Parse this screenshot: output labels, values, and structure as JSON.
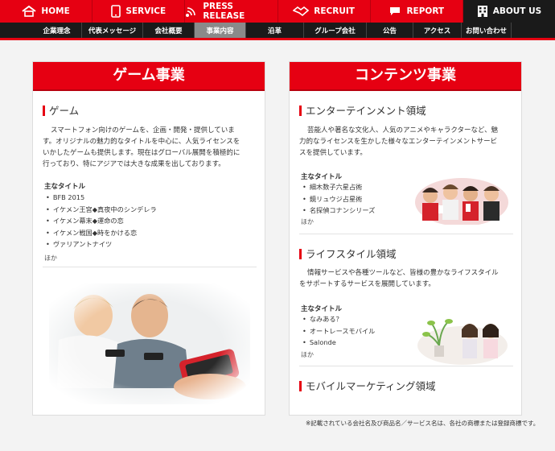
{
  "topnav": [
    {
      "label": "HOME",
      "icon": "home-icon"
    },
    {
      "label": "SERVICE",
      "icon": "smartphone-icon"
    },
    {
      "label": "PRESS RELEASE",
      "icon": "broadcast-icon"
    },
    {
      "label": "RECRUIT",
      "icon": "handshake-icon"
    },
    {
      "label": "REPORT",
      "icon": "chat-bubble-icon"
    },
    {
      "label": "ABOUT US",
      "icon": "building-icon"
    }
  ],
  "subnav": [
    "企業理念",
    "代表メッセージ",
    "会社概要",
    "事業内容",
    "沿革",
    "グループ会社",
    "公告",
    "アクセス",
    "お問い合わせ"
  ],
  "left": {
    "title": "ゲーム事業",
    "heading": "ゲーム",
    "text1": "スマートフォン向けのゲームを、企画・開発・提供していま",
    "text2": "す。オリジナルの魅力的なタイトルを中心に、人気ライセンスを",
    "text3": "いかしたゲームも提供します。現在はグローバル展開を積極的に",
    "text4": "行っており、特にアジアでは大きな成果を出しております。",
    "titles_label": "主なタイトル",
    "titles": [
      "BFB 2015",
      "イケメン王宮◆真夜中のシンデレラ",
      "イケメン幕末◆運命の恋",
      "イケメン戦国◆時をかける恋",
      "ヴァリアントナイツ"
    ],
    "other": "ほか"
  },
  "right": {
    "title": "コンテンツ事業",
    "ent": {
      "heading": "エンターテインメント領域",
      "text1": "芸能人や著名な文化人、人気のアニメやキャラクターなど、魅",
      "text2": "力的なライセンスを生かした様々なエンターテインメントサービ",
      "text3": "スを提供しています。",
      "titles_label": "主なタイトル",
      "titles": [
        "細木数子六星占術",
        "鏡リュウジ占星術",
        "名探偵コナンシリーズ"
      ],
      "other": "ほか"
    },
    "life": {
      "heading": "ライフスタイル領域",
      "text1": "情報サービスや各種ツールなど、皆様の豊かなライフスタイル",
      "text2": "をサポートするサービスを展開しています。",
      "titles_label": "主なタイトル",
      "titles": [
        "なみある？",
        "オートレースモバイル",
        "Salonde"
      ],
      "other": "ほか"
    },
    "mobile": {
      "heading": "モバイルマーケティング領域"
    }
  },
  "footnote": "※記載されている会社名及び商品名／サービス名は、各社の商標または登録商標です。",
  "colors": {
    "brand_red": "#e60012",
    "nav_dark": "#1a1a1a",
    "subnav_active": "#8a8a8a"
  }
}
